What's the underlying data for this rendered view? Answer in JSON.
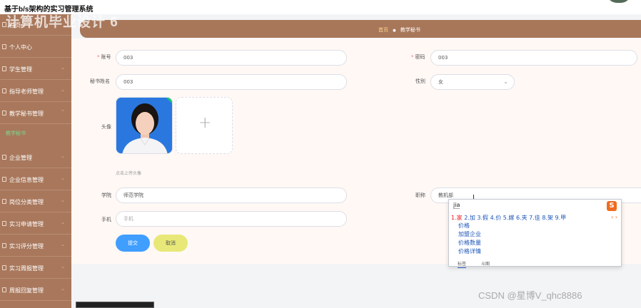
{
  "app": {
    "system_title": "基于b/s架构的实习管理系统",
    "watermark_title": "计算机毕业设计 6"
  },
  "sidebar": {
    "items": [
      {
        "label": "首页"
      },
      {
        "label": "个人中心"
      },
      {
        "label": "学生管理"
      },
      {
        "label": "指导老师管理"
      },
      {
        "label": "教学秘书管理"
      },
      {
        "label": "企业管理"
      },
      {
        "label": "企业信息管理"
      },
      {
        "label": "岗位分类管理"
      },
      {
        "label": "实习申请管理"
      },
      {
        "label": "实习评分管理"
      },
      {
        "label": "实习周报管理"
      },
      {
        "label": "周报回复管理"
      }
    ],
    "sub_item": "教学秘书"
  },
  "breadcrumb": {
    "home": "首页",
    "separator": "●",
    "current": "教学秘书"
  },
  "form": {
    "account_label": "账号",
    "account_value": "003",
    "password_label": "密码",
    "password_value": "003",
    "name_label": "秘书姓名",
    "name_value": "003",
    "gender_label": "性别",
    "gender_value": "女",
    "avatar_label": "头像",
    "upload_tip": "点击上传头像",
    "college_label": "学院",
    "college_value": "师范学院",
    "title_label": "职称",
    "title_value": "教机部",
    "phone_label": "手机",
    "phone_placeholder": "手机",
    "submit_label": "提交",
    "cancel_label": "取消"
  },
  "ime": {
    "input": "jia",
    "logo": "S",
    "candidates": [
      "1.家",
      "2.加",
      "3.假",
      "4.价",
      "5.嫁",
      "6.夹",
      "7.佳",
      "8.架",
      "9.甲"
    ],
    "nav": "‹ ›",
    "suggestions": [
      "价格",
      "加盟企业",
      "价格数量",
      "价格详情"
    ],
    "tabs": [
      "标签",
      "斗图"
    ]
  },
  "footer": {
    "watermark": "CSDN @星博V_qhc8886"
  }
}
